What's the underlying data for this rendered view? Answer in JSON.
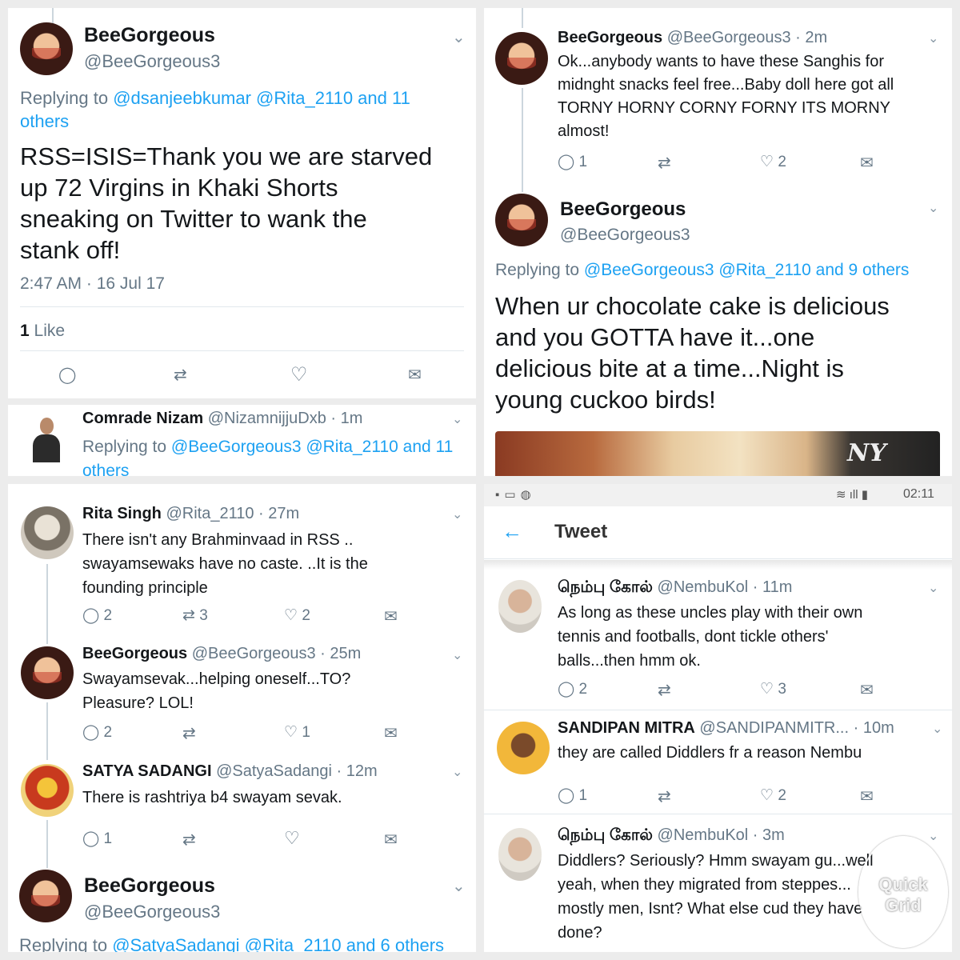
{
  "tl": {
    "name": "BeeGorgeous",
    "handle": "@BeeGorgeous3",
    "replying_prefix": "Replying to ",
    "replying_line1": "@dsanjeebkumar @Rita_2110 and 11",
    "replying_line2": "others",
    "text_lines": [
      "RSS=ISIS=Thank you we are starved",
      "up 72 Virgins in Khaki Shorts",
      "sneaking on Twitter to wank the",
      "stank off!"
    ],
    "timestamp": "2:47 AM · 16 Jul 17",
    "likes_count": "1",
    "likes_label": " Like",
    "reply2": {
      "name": "Comrade Nizam",
      "handle": "@NizamnijjuDxb · 1m",
      "replying_prefix": "Replying to ",
      "replying_line1": "@BeeGorgeous3 @Rita_2110 and 11",
      "replying_line2": "others"
    }
  },
  "tr": {
    "t1": {
      "name": "BeeGorgeous",
      "handle": "@BeeGorgeous3 · 2m",
      "text_lines": [
        "Ok...anybody wants to have these Sanghis for",
        "midnght snacks feel free...Baby doll here got all",
        "TORNY HORNY CORNY FORNY ITS MORNY",
        "almost!"
      ],
      "replies": "1",
      "likes": "2"
    },
    "t2": {
      "name": "BeeGorgeous",
      "handle": "@BeeGorgeous3",
      "replying_prefix": "Replying to ",
      "replying_mentions": "@BeeGorgeous3 @Rita_2110 and 9 others",
      "text_lines": [
        "When ur chocolate cake is delicious",
        "and you GOTTA have it...one",
        "delicious bite at a time...Night is",
        "young cuckoo birds!"
      ],
      "image_text": "NY"
    }
  },
  "bl": {
    "t1": {
      "name": "Rita Singh",
      "handle": "@Rita_2110 · 27m",
      "text_lines": [
        "There isn't any Brahminvaad in RSS ..",
        "swayamsewaks have no caste. ..It is the",
        "founding principle"
      ],
      "replies": "2",
      "retweets": "3",
      "likes": "2"
    },
    "t2": {
      "name": "BeeGorgeous",
      "handle": "@BeeGorgeous3 · 25m",
      "text_lines": [
        "Swayamsevak...helping oneself...TO?",
        "Pleasure? LOL!"
      ],
      "replies": "2",
      "likes": "1"
    },
    "t3": {
      "name": "SATYA SADANGI",
      "handle": "@SatyaSadangi · 12m",
      "text_lines": [
        "There is rashtriya b4 swayam sevak."
      ],
      "replies": "1"
    },
    "t4": {
      "name": "BeeGorgeous",
      "handle": "@BeeGorgeous3",
      "replying_prefix": "Replying to ",
      "replying_mentions": "@SatyaSadangi @Rita_2110 and 6 others"
    }
  },
  "br": {
    "status_time": "02:11",
    "header_title": "Tweet",
    "t1": {
      "name": "நெம்பு கோல்",
      "handle": "@NembuKol · 11m",
      "text_lines": [
        "As long as these uncles play with their own",
        "tennis and footballs, dont tickle others'",
        "balls...then hmm ok."
      ],
      "replies": "2",
      "likes": "3"
    },
    "t2": {
      "name": "SANDIPAN MITRA",
      "handle": "@SANDIPANMITR...",
      "time": "· 10m",
      "text_lines": [
        "they are called Diddlers fr a reason Nembu"
      ],
      "replies": "1",
      "likes": "2"
    },
    "t3": {
      "name": "நெம்பு கோல்",
      "handle": "@NembuKol · 3m",
      "text_lines": [
        "Diddlers? Seriously? Hmm swayam gu...well",
        "yeah, when they migrated from steppes...",
        "mostly men, Isnt? What else cud they have",
        "done?"
      ]
    },
    "watermark_line1": "Quick",
    "watermark_line2": "Grid"
  },
  "icons": {
    "reply": "◯",
    "retweet": "⇄",
    "like": "♡",
    "dm": "✉",
    "chevron": "⌄",
    "back": "←"
  }
}
